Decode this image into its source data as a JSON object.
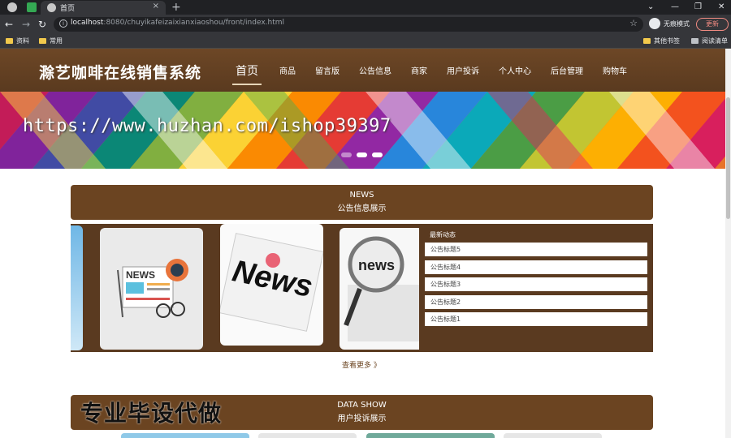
{
  "browser": {
    "tab_title": "首页",
    "url_host": "localhost",
    "url_rest": ":8080/chuyikafeizaixianxiaoshou/front/index.html",
    "incognito_label": "无痕模式",
    "update_label": "更新",
    "bookmarks": [
      "资料",
      "常用"
    ],
    "bookmarks_right": [
      "其他书签",
      "阅读清单"
    ],
    "new_tab": "+",
    "tab_close": "×",
    "win_minimize": "—",
    "win_restore": "❐",
    "win_close": "✕",
    "back": "←",
    "forward": "→",
    "reload": "↻"
  },
  "site": {
    "logo": "滁艺咖啡在线销售系统",
    "nav": [
      "首页",
      "商品",
      "留言版",
      "公告信息",
      "商家",
      "用户投诉",
      "个人中心",
      "后台管理",
      "购物车"
    ],
    "active_nav": "首页",
    "banner_watermark": "https://www.huzhan.com/ishop39397",
    "news_section": {
      "en": "NEWS",
      "cn": "公告信息展示"
    },
    "latest": {
      "title": "最新动态",
      "items": [
        "公告标题5",
        "公告标题4",
        "公告标题3",
        "公告标题2",
        "公告标题1"
      ]
    },
    "more_label": "查看更多 》",
    "data_section": {
      "en": "DATA SHOW",
      "cn": "用户投诉展示"
    },
    "overlay_text": "专业毕设代做",
    "cards": [
      "NEWS",
      "News",
      "news"
    ]
  },
  "colors": {
    "brand_brown": "#6b4421",
    "dark_brown": "#5a3a20"
  }
}
